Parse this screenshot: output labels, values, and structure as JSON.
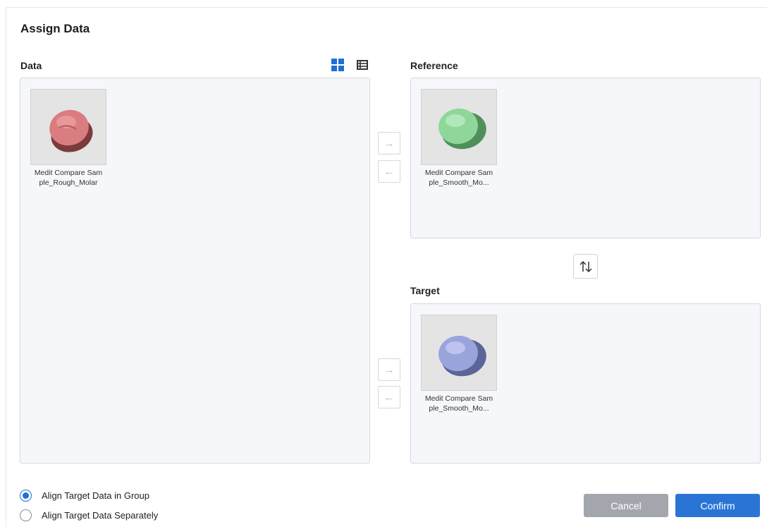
{
  "dialog": {
    "title": "Assign Data"
  },
  "data_section": {
    "label": "Data",
    "view_modes": [
      "grid-view-icon",
      "list-view-icon"
    ],
    "active_view": "grid",
    "items": [
      {
        "name": "Medit Compare Sample_Rough_Molar",
        "color": "#d97d80"
      }
    ]
  },
  "reference_section": {
    "label": "Reference",
    "items": [
      {
        "name": "Medit Compare Sample_Smooth_Mo...",
        "color": "#8fd69a"
      }
    ]
  },
  "target_section": {
    "label": "Target",
    "items": [
      {
        "name": "Medit Compare Sample_Smooth_Mo...",
        "color": "#9aa4dc"
      }
    ]
  },
  "transfer": {
    "move_right_icon": "arrow-right-icon",
    "move_left_icon": "arrow-left-icon",
    "swap_icon": "swap-vertical-icon"
  },
  "options": {
    "align_group": {
      "label": "Align Target Data in Group",
      "checked": true
    },
    "align_separately": {
      "label": "Align Target Data Separately",
      "checked": false
    }
  },
  "buttons": {
    "cancel": "Cancel",
    "confirm": "Confirm"
  },
  "colors": {
    "accent": "#2a74d6",
    "cancel": "#a3a7ad",
    "panel_bg": "#f6f7fa"
  }
}
